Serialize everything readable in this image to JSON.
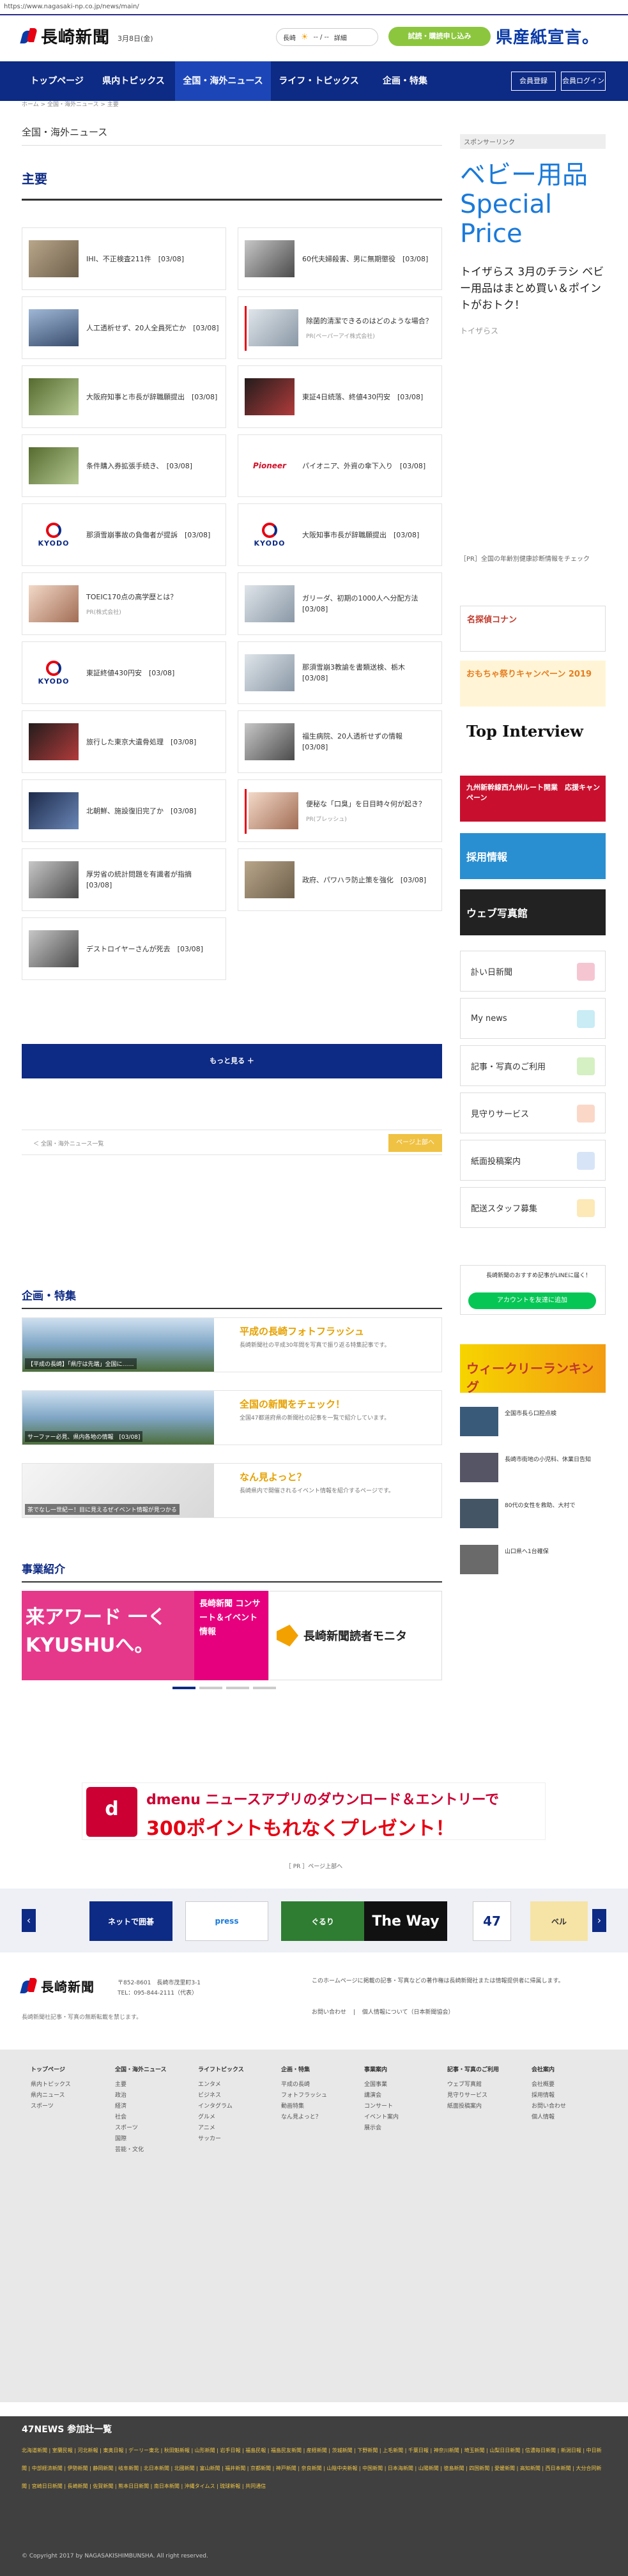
{
  "browser": {
    "url": "https://www.nagasaki-np.co.jp/news/main/"
  },
  "header": {
    "logo": "長崎新聞",
    "date": "3月8日(金)",
    "weather_city": "長崎",
    "weather_temp": "-- / --",
    "weather_more": "詳細",
    "trial_label": "試読・購読申し込み",
    "slogan": "県産紙宣言。"
  },
  "nav": {
    "items": [
      "トップページ",
      "県内トピックス",
      "全国・海外ニュース",
      "ライフ・トピックス",
      "企画・特集"
    ],
    "member_register": "会員登録",
    "login": "会員ログイン"
  },
  "breadcrumb": "ホーム > 全国・海外ニュース > 主要",
  "content": {
    "section_label": "全国・海外ニュース",
    "heading": "主要",
    "cards": [
      {
        "title": "IHI、不正検査211件　[03/08]"
      },
      {
        "title": "60代夫婦殺害、男に無期懲役　[03/08]"
      },
      {
        "title": "人工透析せず、20人全員死亡か　[03/08]"
      },
      {
        "title": "除菌的清潔できるのはどのような場合？",
        "sub": "PR(ペーパーアイ株式会社)"
      },
      {
        "title": "大阪府知事と市長が辞職願提出　[03/08]"
      },
      {
        "title": "東証4日続落、終値430円安　[03/08]"
      },
      {
        "title": "条件購入券拡張手続き、　[03/08]"
      },
      {
        "title": "パイオニア、外資の傘下入り　[03/08]"
      },
      {
        "title": "那須雪崩事故の負傷者が提訴　[03/08]"
      },
      {
        "title": "大阪知事市長が辞職願提出　[03/08]"
      },
      {
        "title": "TOEIC170点の高学歴とは？",
        "sub": "PR(株式会社)"
      },
      {
        "title": "ガリーダ、初期の1000人へ分配方法　[03/08]"
      },
      {
        "title": "東証終値430円安　[03/08]"
      },
      {
        "title": "那須雪崩3教諭を書類送検、栃木　[03/08]"
      },
      {
        "title": "旅行した東京大遺骨処理　[03/08]"
      },
      {
        "title": "福生病院、20人透析せずの情報　[03/08]"
      },
      {
        "title": "北朝鮮、施設復旧完了か　[03/08]"
      },
      {
        "title": "便秘な「口臭」を日目時々何が起き？",
        "sub": "PR(ブレッシュ)"
      },
      {
        "title": "厚労省の統計問題を有識者が指摘　[03/08]"
      },
      {
        "title": "政府、パワハラ防止策を強化　[03/08]"
      },
      {
        "title": "デストロイヤーさんが死去　[03/08]"
      }
    ],
    "more_label": "もっと見る ＋",
    "back_label": "＜ 全国・海外ニュース一覧",
    "page_top_label": "ページ上部へ"
  },
  "features": {
    "heading": "企画・特集",
    "items": [
      {
        "title": "平成の長崎フォトフラッシュ",
        "caption": "【平成の長崎】「県庁は先端」全国に……",
        "desc": "長崎新聞社の平成30年間を写真で振り返る特集記事です。"
      },
      {
        "title": "全国の新聞をチェック！",
        "caption": "サーファー必見、県内各地の情報　[03/08]",
        "desc": "全国47都道府県の新聞社の記事を一覧で紹介しています。"
      },
      {
        "title": "なん見よっと？",
        "caption": "茶でなし一世紀ー！目に見えるぜイベント情報が見つかる",
        "desc": "長崎県内で開催されるイベント情報を紹介するページです。"
      }
    ]
  },
  "business": {
    "heading": "事業紹介",
    "banner_a": "来アワード 一く KYUSHUへ。",
    "banner_b": "長崎新聞 コンサート＆イベント情報",
    "banner_c": "長崎新聞読者モニタ"
  },
  "sidebar": {
    "sponsor": "スポンサーリンク",
    "ad_title": "ベビー用品 Special Price",
    "ad_text": "トイザらス 3月のチラシ ベビー用品はまとめ買い＆ポイントがおトク！",
    "ad_source": "トイザらス",
    "text_ad": "［PR］全国の年齢別健康診断情報をチェック",
    "banners": [
      "名探偵コナン",
      "おもちゃ祭りキャンペーン 2019",
      "Top Interview",
      "九州新幹線西九州ルート開業　応援キャンペーン",
      "採用情報",
      "ウェブ写真館"
    ],
    "links": [
      "訃い日新聞",
      "My news",
      "記事・写真のご利用",
      "見守りサービス",
      "紙面投稿案内",
      "配送スタッフ募集"
    ],
    "line_title": "長崎新聞のおすすめ記事がLINEに届く！",
    "line_btn": "アカウントを友達に追加",
    "weekly": "ウィークリーランキング",
    "news": [
      "全国市長ら口腔点検",
      "長崎市街地の小児科、休業日告知",
      "80代の女性を救助、大村で",
      "山口県へ1台確保"
    ]
  },
  "ads": {
    "dpoint_line1": "dmenu ニュースアプリのダウンロード＆エントリーで",
    "dpoint_line2": "300ポイントもれなくプレゼント！",
    "dpoint_logo": "d",
    "pr_caption": "［ PR ］ページ上部へ"
  },
  "carousel": [
    "ネットで囲碁",
    "press",
    "ぐるり",
    "The Way",
    "47",
    "ベル"
  ],
  "footer": {
    "logo": "長崎新聞",
    "address": "〒852-8601　長崎市茂里町3-1",
    "tel": "TEL：095-844-2111（代表）",
    "note": "長崎新聞社記事・写真の無断転載を禁じます。",
    "right_text": "このホームページに掲載の記事・写真などの著作権は長崎新聞社または情報提供者に帰属します。",
    "link1": "お問い合わせ",
    "link2": "個人情報について（日本新聞協会）"
  },
  "sitemap": {
    "cols": [
      {
        "head": "トップページ",
        "items": [
          "県内トピックス",
          "県内ニュース",
          "スポーツ"
        ]
      },
      {
        "head": "全国・海外ニュース",
        "items": [
          "主要",
          "政治",
          "経済",
          "社会",
          "スポーツ",
          "国際",
          "芸能・文化"
        ]
      },
      {
        "head": "ライフトピックス",
        "items": [
          "エンタメ",
          "ビジネス",
          "インタグラム",
          "グルメ",
          "アニメ",
          "サッカー"
        ]
      },
      {
        "head": "企画・特集",
        "items": [
          "平成の長崎",
          "フォトフラッシュ",
          "動画特集",
          "なん見よっと？"
        ]
      },
      {
        "head": "事業案内",
        "items": [
          "全国事業",
          "講演会",
          "コンサート",
          "イベント案内",
          "展示会"
        ]
      },
      {
        "head": "記事・写真のご利用",
        "items": [
          "ウェブ写真館",
          "見守りサービス",
          "紙面投稿案内"
        ]
      },
      {
        "head": "会社案内",
        "items": [
          "会社概要",
          "採用情報",
          "お問い合わせ",
          "個人情報"
        ]
      }
    ]
  },
  "bottom": {
    "title": "47NEWS 参加社一覧",
    "links": "北海道新聞 | 室蘭民報 | 河北新報 | 東奥日報 | デーリー東北 | 秋田魁新報 | 山形新聞 | 岩手日報 | 福島民報 | 福島民友新聞 | 産経新聞 | 茨城新聞 | 下野新聞 | 上毛新聞 | 千葉日報 | 神奈川新聞 | 埼玉新聞 | 山梨日日新聞 | 信濃毎日新聞 | 新潟日報 | 中日新聞 | 中部経済新聞 | 伊勢新聞 | 静岡新聞 | 岐阜新聞 | 北日本新聞 | 北國新聞 | 富山新聞 | 福井新聞 | 京都新聞 | 神戸新聞 | 奈良新聞 | 山陰中央新報 | 中国新聞 | 日本海新聞 | 山陽新聞 | 徳島新聞 | 四国新聞 | 愛媛新聞 | 高知新聞 | 西日本新聞 | 大分合同新聞 | 宮崎日日新聞 | 長崎新聞 | 佐賀新聞 | 熊本日日新聞 | 南日本新聞 | 沖縄タイムス | 琉球新報 | 共同通信",
    "copyright": "© Copyright 2017 by NAGASAKISHIMBUNSHA. All right reserved."
  },
  "colors": {
    "brand_blue": "#0d2a84",
    "accent_red": "#e60012",
    "accent_green": "#8cc63f",
    "accent_yellow": "#f0c243"
  }
}
